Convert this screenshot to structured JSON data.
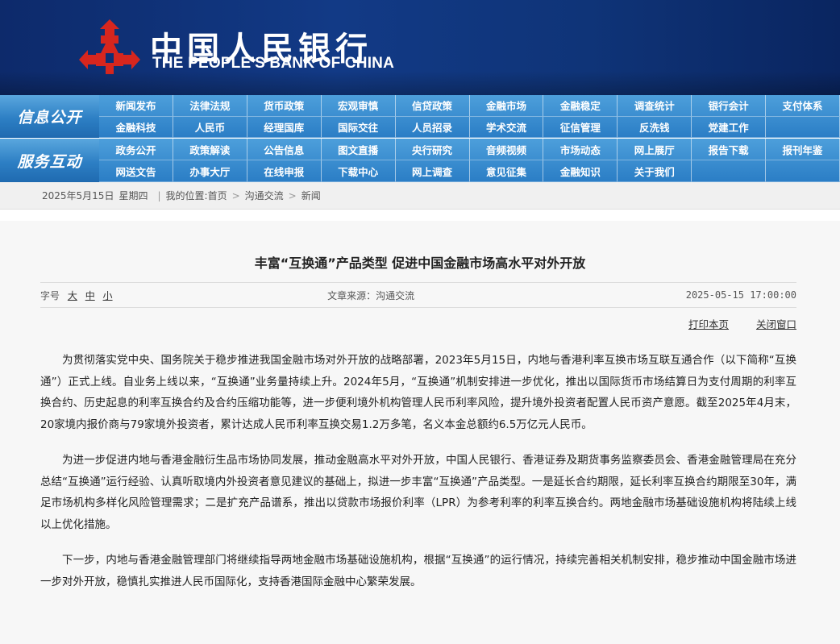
{
  "header": {
    "logo_cn": "中国人民银行",
    "logo_en": "THE PEOPLE'S BANK OF CHINA",
    "logo_color": "#d7261e"
  },
  "nav": {
    "info": {
      "label": "信息公开",
      "items": [
        "新闻发布",
        "法律法规",
        "货币政策",
        "宏观审慎",
        "信贷政策",
        "金融市场",
        "金融稳定",
        "调查统计",
        "银行会计",
        "支付体系",
        "金融科技",
        "人民币",
        "经理国库",
        "国际交往",
        "人员招录",
        "学术交流",
        "征信管理",
        "反洗钱",
        "党建工作",
        ""
      ]
    },
    "service": {
      "label": "服务互动",
      "items": [
        "政务公开",
        "政策解读",
        "公告信息",
        "图文直播",
        "央行研究",
        "音频视频",
        "市场动态",
        "网上展厅",
        "报告下载",
        "报刊年鉴",
        "网送文告",
        "办事大厅",
        "在线申报",
        "下载中心",
        "网上调查",
        "意见征集",
        "金融知识",
        "关于我们",
        "",
        ""
      ]
    }
  },
  "breadcrumb": {
    "date": "2025年5月15日",
    "weekday": "星期四",
    "location_label": "我的位置:",
    "home": "首页",
    "section": "沟通交流",
    "current": "新闻"
  },
  "article": {
    "title": "丰富“互换通”产品类型  促进中国金融市场高水平对外开放",
    "font_size_label": "字号",
    "size_large": "大",
    "size_medium": "中",
    "size_small": "小",
    "source": "文章来源：沟通交流",
    "datetime": "2025-05-15 17:00:00",
    "print": "打印本页",
    "close": "关闭窗口",
    "paragraphs": [
      "为贯彻落实党中央、国务院关于稳步推进我国金融市场对外开放的战略部署，2023年5月15日，内地与香港利率互换市场互联互通合作（以下简称“互换通”）正式上线。自业务上线以来，“互换通”业务量持续上升。2024年5月，“互换通”机制安排进一步优化，推出以国际货币市场结算日为支付周期的利率互换合约、历史起息的利率互换合约及合约压缩功能等，进一步便利境外机构管理人民币利率风险，提升境外投资者配置人民币资产意愿。截至2025年4月末，20家境内报价商与79家境外投资者，累计达成人民币利率互换交易1.2万多笔，名义本金总额约6.5万亿元人民币。",
      "为进一步促进内地与香港金融衍生品市场协同发展，推动金融高水平对外开放，中国人民银行、香港证券及期货事务监察委员会、香港金融管理局在充分总结“互换通”运行经验、认真听取境内外投资者意见建议的基础上，拟进一步丰富“互换通”产品类型。一是延长合约期限，延长利率互换合约期限至30年，满足市场机构多样化风险管理需求；二是扩充产品谱系，推出以贷款市场报价利率（LPR）为参考利率的利率互换合约。两地金融市场基础设施机构将陆续上线以上优化措施。",
      "下一步，内地与香港金融管理部门将继续指导两地金融市场基础设施机构，根据“互换通”的运行情况，持续完善相关机制安排，稳步推动中国金融市场进一步对外开放，稳慎扎实推进人民币国际化，支持香港国际金融中心繁荣发展。"
    ]
  }
}
